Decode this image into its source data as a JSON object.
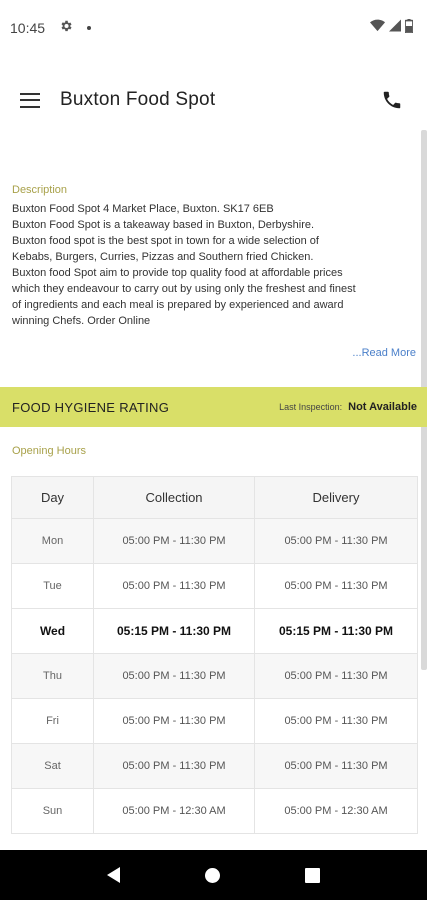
{
  "status_bar": {
    "time": "10:45"
  },
  "app_bar": {
    "title": "Buxton Food Spot"
  },
  "description": {
    "label": "Description",
    "lines": [
      "Buxton Food Spot 4 Market Place, Buxton. SK17 6EB",
      "Buxton Food Spot is a takeaway based in Buxton, Derbyshire.",
      "Buxton food spot is the best spot in town for a wide selection of",
      "Kebabs, Burgers, Curries, Pizzas and Southern fried Chicken.",
      "Buxton food Spot aim to provide top quality food at affordable prices",
      "which they endeavour to carry out by using only the freshest and finest",
      "of ingredients and each meal is prepared by experienced and award",
      "winning Chefs. Order Online"
    ],
    "read_more": "...Read More"
  },
  "hygiene": {
    "title": "FOOD HYGIENE RATING",
    "last_inspection_label": "Last Inspection:",
    "last_inspection_value": "Not Available",
    "bar_color": "#d9df68"
  },
  "opening_hours": {
    "label": "Opening Hours",
    "headers": [
      "Day",
      "Collection",
      "Delivery"
    ],
    "rows": [
      {
        "day": "Mon",
        "collection": "05:00 PM - 11:30 PM",
        "delivery": "05:00 PM - 11:30 PM"
      },
      {
        "day": "Tue",
        "collection": "05:00 PM - 11:30 PM",
        "delivery": "05:00 PM - 11:30 PM"
      },
      {
        "day": "Wed",
        "collection": "05:15 PM - 11:30 PM",
        "delivery": "05:15 PM - 11:30 PM"
      },
      {
        "day": "Thu",
        "collection": "05:00 PM - 11:30 PM",
        "delivery": "05:00 PM - 11:30 PM"
      },
      {
        "day": "Fri",
        "collection": "05:00 PM - 11:30 PM",
        "delivery": "05:00 PM - 11:30 PM"
      },
      {
        "day": "Sat",
        "collection": "05:00 PM - 11:30 PM",
        "delivery": "05:00 PM - 11:30 PM"
      },
      {
        "day": "Sun",
        "collection": "05:00 PM - 12:30 AM",
        "delivery": "05:00 PM - 12:30 AM"
      }
    ],
    "current_day": "Wed"
  },
  "icons": {
    "status": [
      "gear-icon",
      "notification-dot-icon",
      "wifi-icon",
      "signal-icon",
      "battery-icon"
    ],
    "app_bar": [
      "menu-icon",
      "phone-icon"
    ],
    "nav": [
      "back-icon",
      "home-icon",
      "recent-apps-icon"
    ]
  }
}
